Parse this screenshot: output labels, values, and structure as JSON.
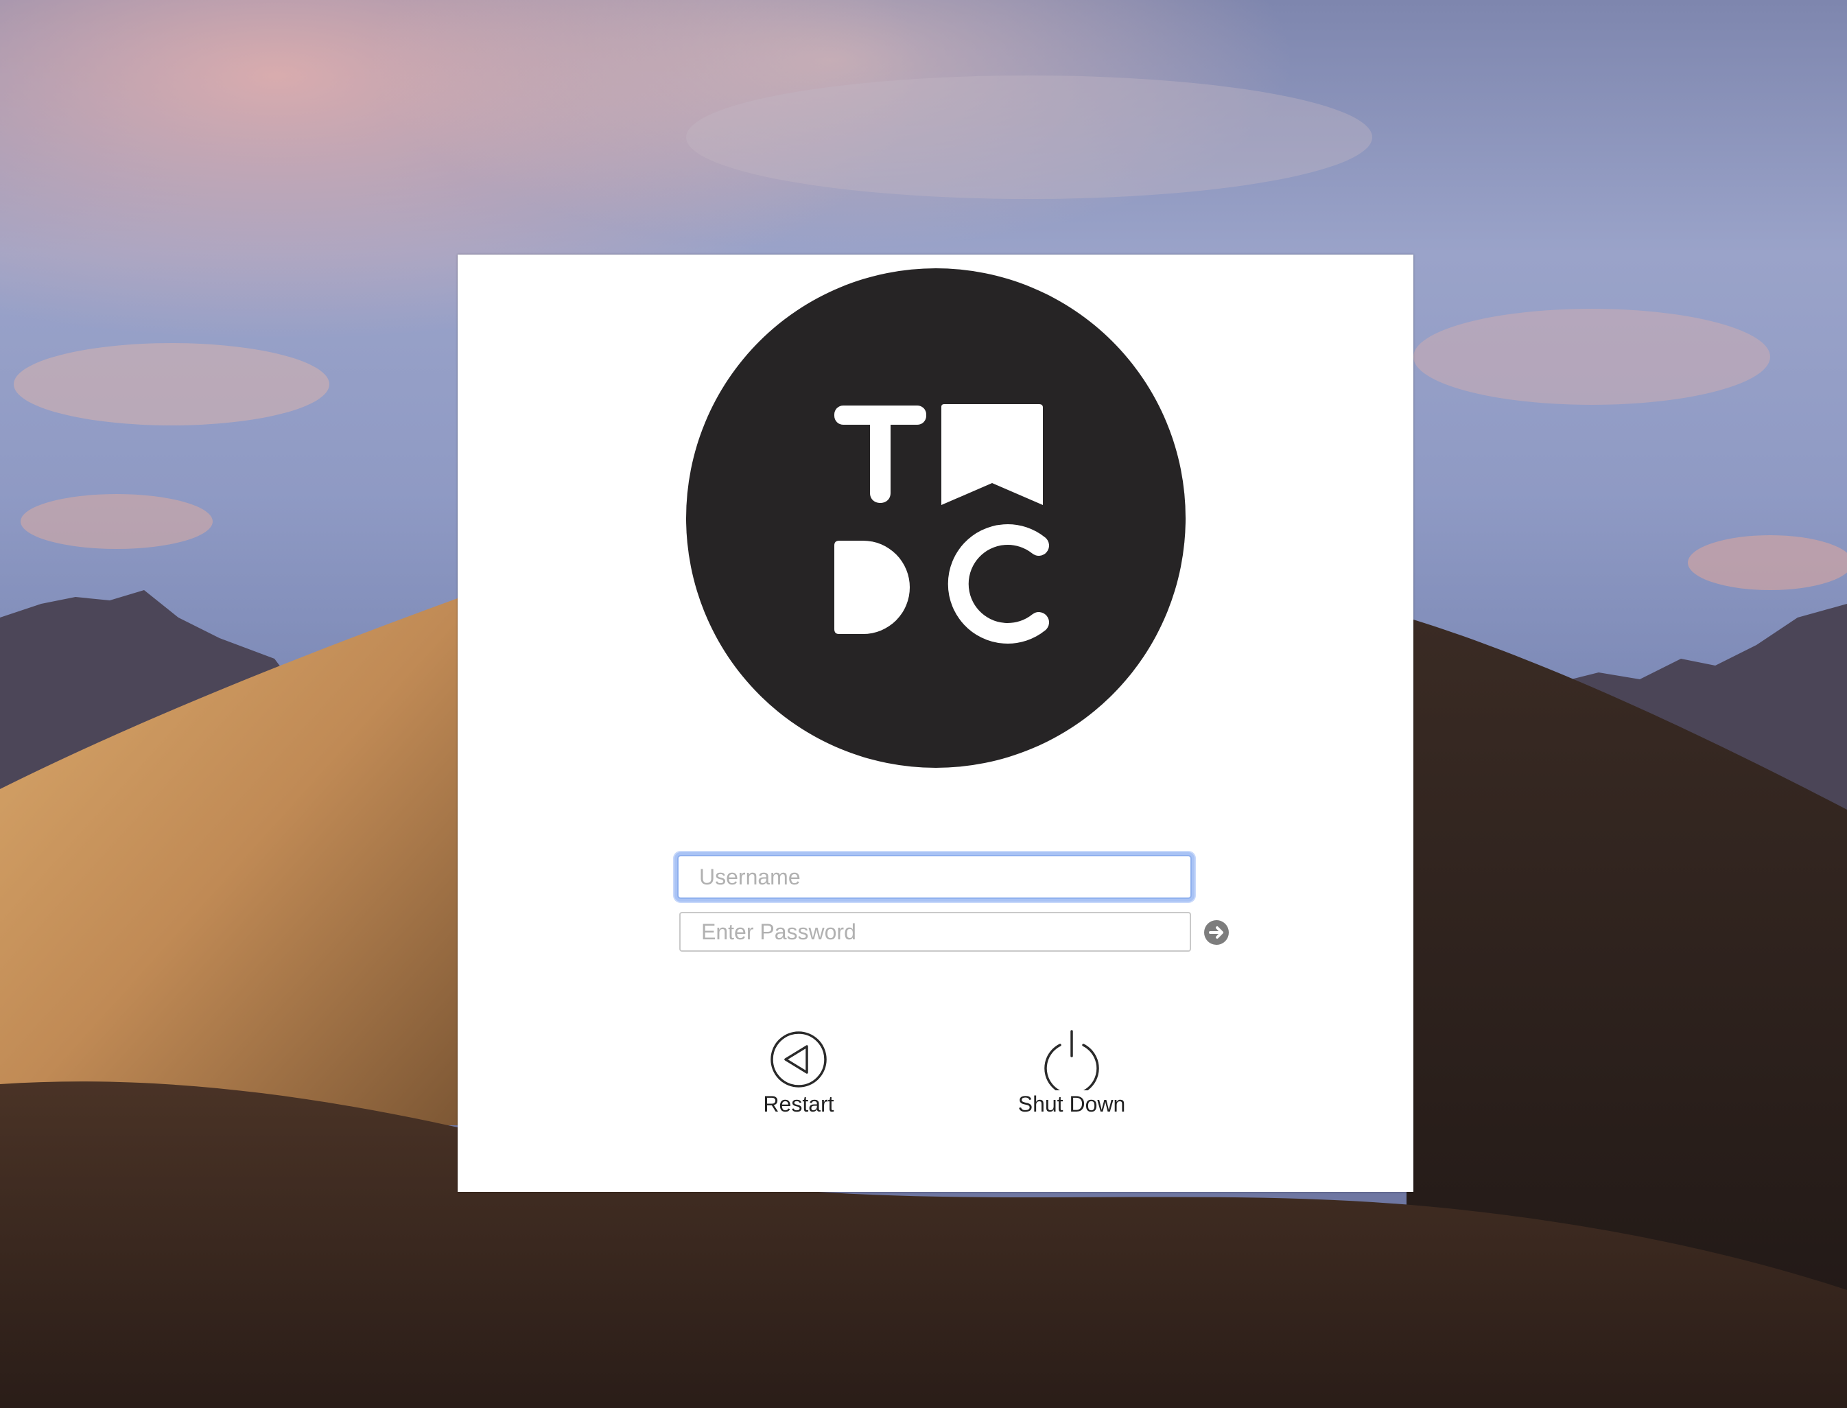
{
  "login": {
    "username_placeholder": "Username",
    "username_value": "",
    "password_placeholder": "Enter Password",
    "password_value": ""
  },
  "actions": {
    "restart_label": "Restart",
    "shutdown_label": "Shut Down"
  },
  "logo": {
    "letters": "TWDC"
  },
  "icons": {
    "submit": "arrow-right-circle-icon",
    "restart": "restart-triangle-icon",
    "shutdown": "power-icon"
  },
  "colors": {
    "panel": "#ffffff",
    "logo_bg": "#262425",
    "focus_ring": "#8fb0ee",
    "text": "#222222"
  }
}
